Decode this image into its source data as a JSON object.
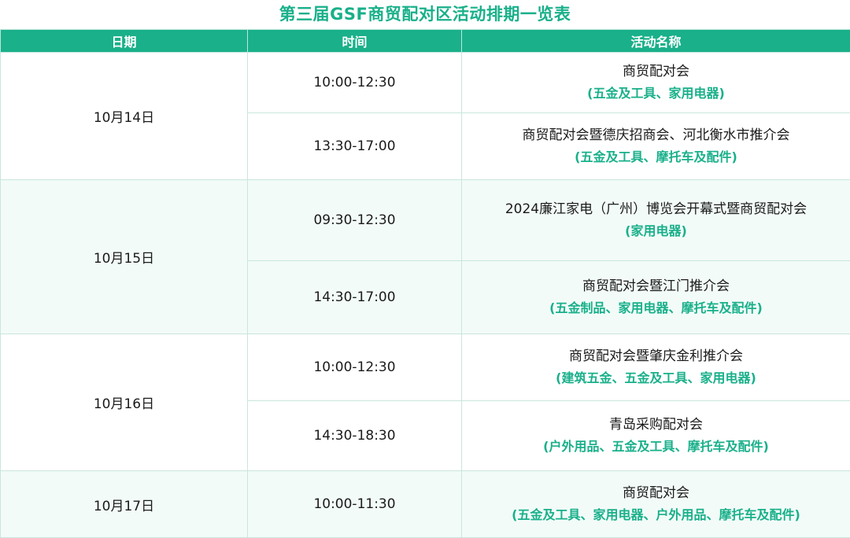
{
  "title": "第三届GSF商贸配对区活动排期一览表",
  "colors": {
    "accent": "#19b08a",
    "alt_row": "#f2fbf8"
  },
  "headers": {
    "date": "日期",
    "time": "时间",
    "activity": "活动名称"
  },
  "days": [
    {
      "date": "10月14日",
      "sessions": [
        {
          "time": "10:00-12:30",
          "name": "商贸配对会",
          "category": "(五金及工具、家用电器)"
        },
        {
          "time": "13:30-17:00",
          "name": "商贸配对会暨德庆招商会、河北衡水市推介会",
          "category": "(五金及工具、摩托车及配件)"
        }
      ]
    },
    {
      "date": "10月15日",
      "sessions": [
        {
          "time": "09:30-12:30",
          "name": "2024廉江家电（广州）博览会开幕式暨商贸配对会",
          "category": "(家用电器)"
        },
        {
          "time": "14:30-17:00",
          "name": "商贸配对会暨江门推介会",
          "category": "(五金制品、家用电器、摩托车及配件)"
        }
      ]
    },
    {
      "date": "10月16日",
      "sessions": [
        {
          "time": "10:00-12:30",
          "name": "商贸配对会暨肇庆金利推介会",
          "category": "(建筑五金、五金及工具、家用电器)"
        },
        {
          "time": "14:30-18:30",
          "name": "青岛采购配对会",
          "category": "(户外用品、五金及工具、摩托车及配件)"
        }
      ]
    },
    {
      "date": "10月17日",
      "sessions": [
        {
          "time": "10:00-11:30",
          "name": "商贸配对会",
          "category": "(五金及工具、家用电器、户外用品、摩托车及配件)"
        }
      ]
    }
  ]
}
